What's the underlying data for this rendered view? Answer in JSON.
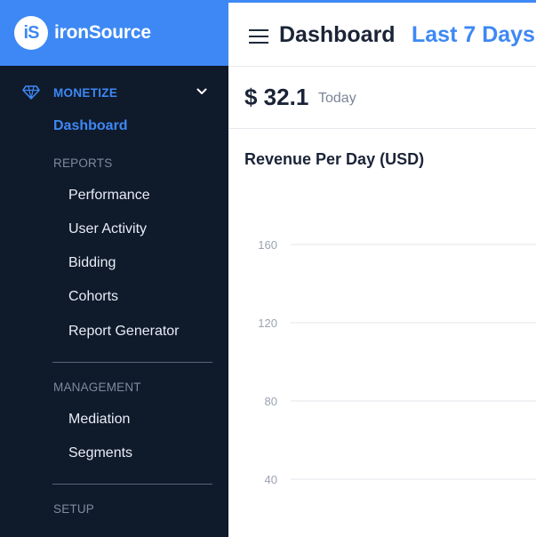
{
  "brand": {
    "logo_text": "iS",
    "name": "ironSource",
    "accent": "#3d88f4"
  },
  "sidebar": {
    "section": {
      "icon": "diamond-icon",
      "label": "MONETIZE",
      "expand_icon": "chevron-down-icon"
    },
    "dashboard_label": "Dashboard",
    "reports_heading": "REPORTS",
    "reports": [
      {
        "label": "Performance"
      },
      {
        "label": "User Activity"
      },
      {
        "label": "Bidding"
      },
      {
        "label": "Cohorts"
      },
      {
        "label": "Report Generator"
      }
    ],
    "management_heading": "MANAGEMENT",
    "management": [
      {
        "label": "Mediation"
      },
      {
        "label": "Segments"
      }
    ],
    "setup_heading": "SETUP"
  },
  "header": {
    "menu_icon": "hamburger-menu-icon",
    "title": "Dashboard",
    "range": "Last 7 Days"
  },
  "summary": {
    "amount": "$ 32.1",
    "period": "Today"
  },
  "chart_data": {
    "type": "line",
    "title": "Revenue Per Day (USD)",
    "xlabel": "",
    "ylabel": "",
    "y_ticks": [
      "160",
      "120",
      "80",
      "40"
    ],
    "grid": true,
    "series": []
  }
}
